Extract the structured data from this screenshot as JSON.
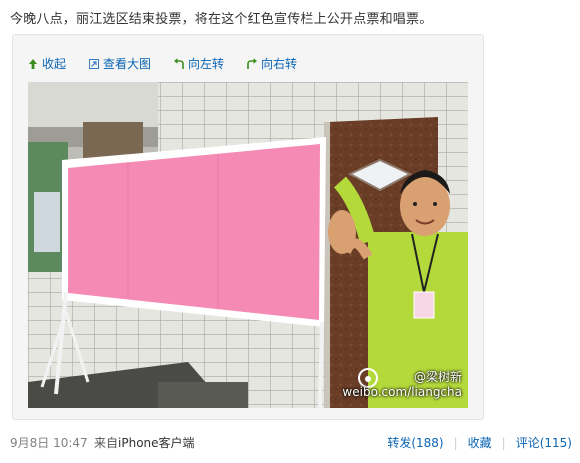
{
  "post": {
    "text": "今晚八点，丽江选区结束投票，将在这个红色宣传栏上公开点票和唱票。"
  },
  "media_toolbar": {
    "collapse_label": "收起",
    "view_large_label": "查看大图",
    "rotate_left_label": "向左转",
    "rotate_right_label": "向右转"
  },
  "photo": {
    "watermark_user": "@梁树新",
    "watermark_url": "weibo.com/liangcha"
  },
  "footer": {
    "time": "9月8日 10:47",
    "source_prefix": "来自",
    "source_app": "iPhone客户端",
    "repost_label": "转发(188)",
    "favorite_label": "收藏",
    "comment_label": "评论(115)"
  },
  "colors": {
    "link": "#0a65b3",
    "board_pink": "#f58bb5",
    "shirt_green": "#b4d93b"
  }
}
